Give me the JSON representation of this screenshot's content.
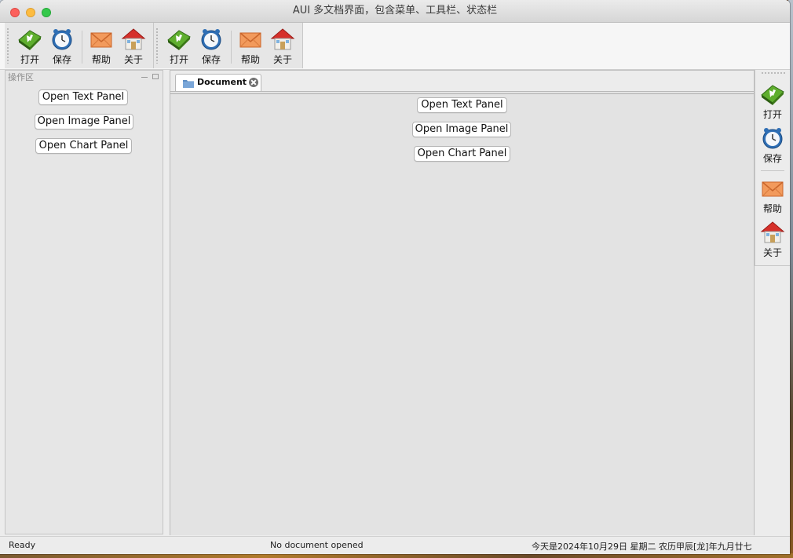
{
  "window": {
    "title": "AUI 多文档界面，包含菜单、工具栏、状态栏"
  },
  "toolbar": {
    "open_label": "打开",
    "save_label": "保存",
    "help_label": "帮助",
    "about_label": "关于"
  },
  "dock": {
    "title": "操作区",
    "buttons": [
      "Open Text Panel",
      "Open Image Panel",
      "Open Chart Panel"
    ]
  },
  "document": {
    "tab_label": "Document",
    "buttons": [
      "Open Text Panel",
      "Open Image Panel",
      "Open Chart Panel"
    ]
  },
  "status": {
    "left": "Ready",
    "center": "No document opened",
    "right": "今天是2024年10月29日 星期二 农历甲辰[龙]年九月廿七"
  },
  "colors": {
    "close": "#fc605c",
    "minimize": "#fdbc40",
    "maximize": "#34c84a"
  }
}
